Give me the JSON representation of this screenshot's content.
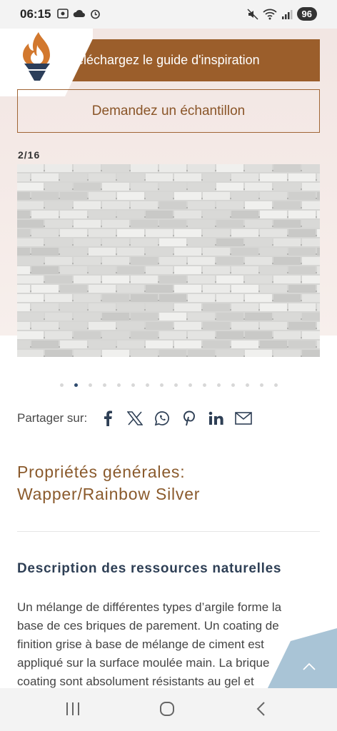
{
  "status_bar": {
    "time": "06:15",
    "battery": "96"
  },
  "header": {
    "guide_button": "Téléchargez le guide d'inspiration",
    "sample_button": "Demandez un échantillon"
  },
  "gallery": {
    "counter": "2/16",
    "total_slides": 16,
    "active_slide": 2
  },
  "share": {
    "label": "Partager sur:",
    "icons": [
      "facebook-icon",
      "x-icon",
      "whatsapp-icon",
      "pinterest-icon",
      "linkedin-icon",
      "mail-icon"
    ]
  },
  "product": {
    "title_line1": "Propriétés générales:",
    "title_line2": "Wapper/Rainbow Silver",
    "section_title": "Description des ressources naturelles",
    "description": "Un mélange de différentes types d’argile forme la base de ces briques de parement. Un coating de finition grise à base de mélange de ciment est appliqué sur la surface moulée main. La brique coating sont absolument résistants au gel et"
  },
  "colors": {
    "accent_brown": "#9b5e2b",
    "title_brown": "#8a5a2c",
    "navy": "#2e3f55",
    "scroll_blue": "#a9c4d6"
  }
}
